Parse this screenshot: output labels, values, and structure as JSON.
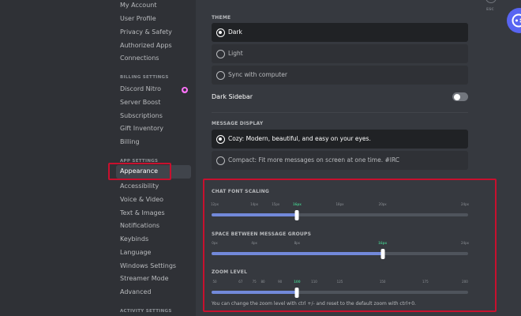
{
  "sidebar": {
    "items": [
      {
        "label": "My Account"
      },
      {
        "label": "User Profile"
      },
      {
        "label": "Privacy & Safety"
      },
      {
        "label": "Authorized Apps"
      },
      {
        "label": "Connections"
      }
    ],
    "billing_heading": "BILLING SETTINGS",
    "billing_items": [
      {
        "label": "Discord Nitro"
      },
      {
        "label": "Server Boost"
      },
      {
        "label": "Subscriptions"
      },
      {
        "label": "Gift Inventory"
      },
      {
        "label": "Billing"
      }
    ],
    "app_heading": "APP SETTINGS",
    "app_items": [
      {
        "label": "Appearance",
        "active": true
      },
      {
        "label": "Accessibility"
      },
      {
        "label": "Voice & Video"
      },
      {
        "label": "Text & Images"
      },
      {
        "label": "Notifications"
      },
      {
        "label": "Keybinds"
      },
      {
        "label": "Language"
      },
      {
        "label": "Windows Settings"
      },
      {
        "label": "Streamer Mode"
      },
      {
        "label": "Advanced"
      }
    ],
    "activity_heading": "ACTIVITY SETTINGS"
  },
  "theme": {
    "heading": "THEME",
    "options": [
      {
        "label": "Dark",
        "selected": true
      },
      {
        "label": "Light",
        "selected": false
      },
      {
        "label": "Sync with computer",
        "selected": false
      }
    ]
  },
  "dark_sidebar": {
    "label": "Dark Sidebar",
    "enabled": false
  },
  "message_display": {
    "heading": "MESSAGE DISPLAY",
    "options": [
      {
        "label": "Cozy: Modern, beautiful, and easy on your eyes.",
        "selected": true
      },
      {
        "label": "Compact: Fit more messages on screen at one time. #IRC",
        "selected": false
      }
    ]
  },
  "chat_font_scaling": {
    "heading": "CHAT FONT SCALING",
    "ticks": [
      "12px",
      "14px",
      "15px",
      "16px",
      "18px",
      "20px",
      "24px"
    ],
    "selected": "16px"
  },
  "message_group_spacing": {
    "heading": "SPACE BETWEEN MESSAGE GROUPS",
    "ticks": [
      "0px",
      "4px",
      "8px",
      "16px",
      "24px"
    ],
    "selected": "16px"
  },
  "zoom_level": {
    "heading": "ZOOM LEVEL",
    "ticks": [
      "50",
      "67",
      "75",
      "80",
      "90",
      "100",
      "110",
      "125",
      "150",
      "175",
      "200"
    ],
    "selected": "100",
    "note": "You can change the zoom level with ctrl +/- and reset to the default zoom with ctrl+0."
  },
  "esc_label": "ESC",
  "colors": {
    "accent": "#7289da",
    "selected_tick": "#43b581",
    "highlight_box": "#c8102e",
    "brand_badge": "#5865f2"
  },
  "icons": {
    "nitro": "nitro-icon",
    "close": "close-icon",
    "brand": "gamepad-icon"
  }
}
